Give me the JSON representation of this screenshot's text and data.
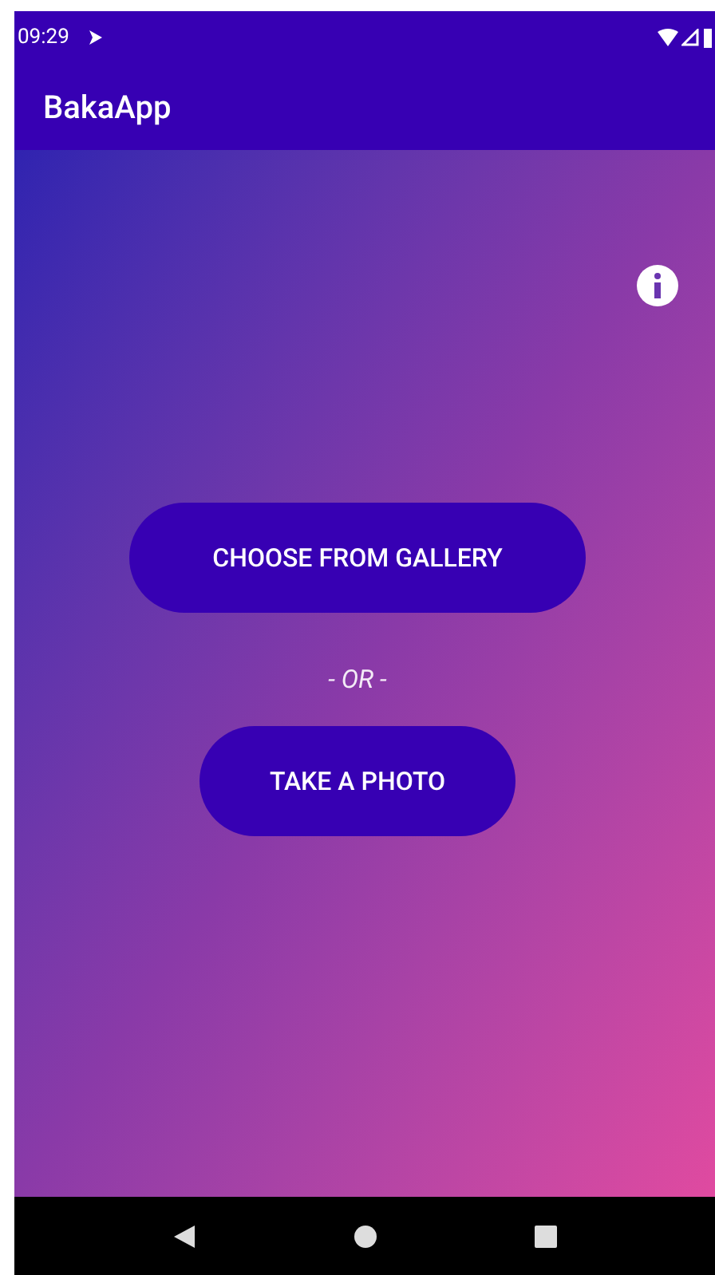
{
  "status_bar": {
    "time": "09:29"
  },
  "app_bar": {
    "title": "BakaApp"
  },
  "buttons": [
    {
      "label": "CHOOSE FROM GALLERY"
    },
    {
      "label": "TAKE A PHOTO"
    }
  ],
  "separator": "- OR -"
}
